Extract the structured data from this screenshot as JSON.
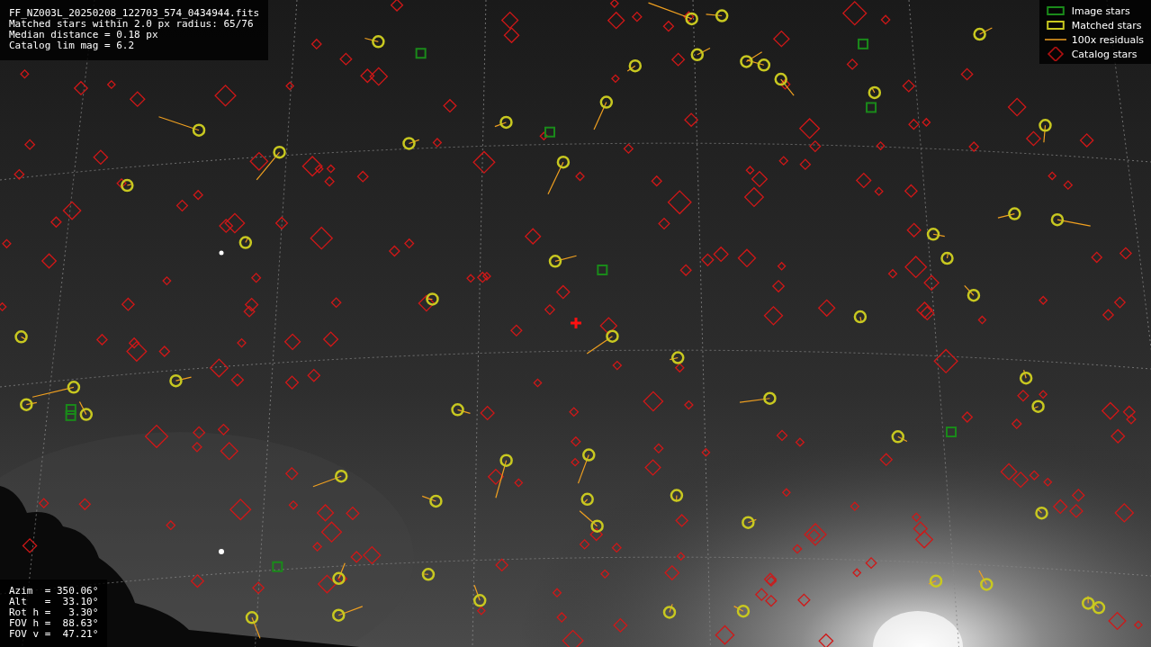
{
  "info": {
    "lines": [
      "FF_NZ003L_20250208_122703_574_0434944.fits",
      "Matched stars within 2.0 px radius: 65/76",
      "Median distance = 0.18 px",
      "Catalog lim mag = 6.2"
    ]
  },
  "legend": {
    "items": [
      {
        "label": "Image stars"
      },
      {
        "kind": "matched",
        "label": "Matched stars"
      },
      {
        "kind": "residual",
        "label": "100x residuals"
      },
      {
        "kind": "catalog",
        "label": "Catalog stars"
      }
    ]
  },
  "pointing": {
    "lines": [
      "Azim  = 350.06°",
      "Alt   =  33.10°",
      "Rot h =   3.30°",
      "FOV h =  88.63°",
      "FOV v =  47.21°"
    ]
  }
}
